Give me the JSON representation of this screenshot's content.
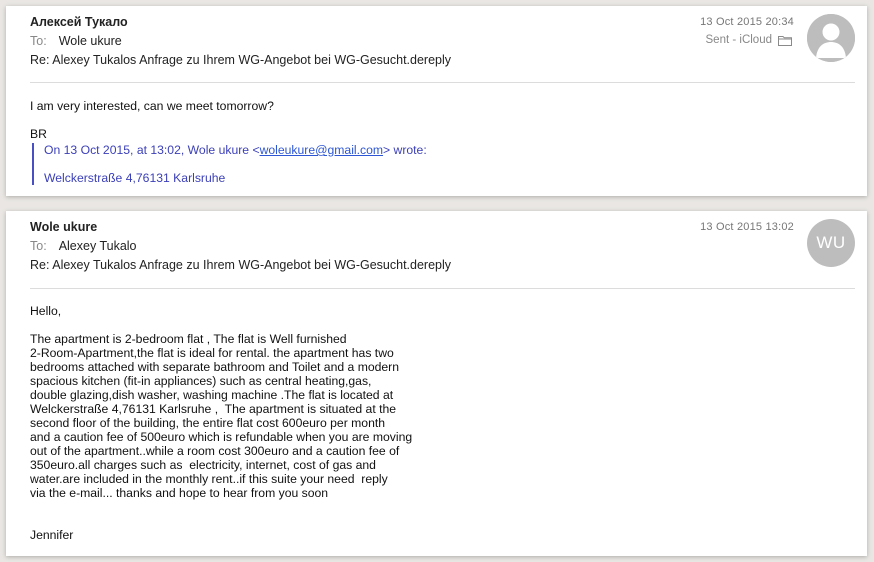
{
  "message1": {
    "from": "Алексей Тукало",
    "to_label": "To:",
    "to": "Wole ukure",
    "subject": "Re: Alexey Tukalos Anfrage zu Ihrem WG-Angebot bei WG-Gesucht.dereply",
    "date": "13 Oct 2015 20:34",
    "mailbox": "Sent - iCloud",
    "mailbox_icon": "folder-icon",
    "avatar_icon": "person-silhouette-icon",
    "body_line1": "I am very interested, can we meet tomorrow?",
    "body_line2": "BR",
    "quote_prefix": "On 13 Oct 2015, at 13:02, Wole ukure <",
    "quote_email": "woleukure@gmail.com",
    "quote_suffix": "> wrote:",
    "quote_address": "Welckerstraße 4,76131 Karlsruhe"
  },
  "message2": {
    "from": "Wole ukure",
    "to_label": "To:",
    "to": "Alexey Tukalo",
    "subject": "Re: Alexey Tukalos Anfrage zu Ihrem WG-Angebot bei WG-Gesucht.dereply",
    "date": "13 Oct 2015 13:02",
    "avatar_initials": "WU",
    "greeting": "Hello,",
    "body_lines": [
      "The apartment is 2-bedroom flat , The flat is Well furnished",
      "2-Room-Apartment,the flat is ideal for rental. the apartment has two",
      "bedrooms attached with separate bathroom and Toilet and a modern",
      "spacious kitchen (fit-in appliances) such as central heating,gas,",
      "double glazing,dish washer, washing machine .The flat is located at",
      "Welckerstraße 4,76131 Karlsruhe ,  The apartment is situated at the",
      "second floor of the building, the entire flat cost 600euro per month",
      "and a caution fee of 500euro which is refundable when you are moving",
      "out of the apartment..while a room cost 300euro and a caution fee of",
      "350euro.all charges such as  electricity, internet, cost of gas and",
      "water.are included in the monthly rent..if this suite your need  reply",
      "via the e-mail... thanks and hope to hear from you soon"
    ],
    "signature": "Jennifer"
  },
  "colors": {
    "quote_text": "#3b3fb8",
    "quote_bar": "#4a4fc2",
    "link": "#2d56d4",
    "avatar_bg": "#bdbdbd"
  }
}
